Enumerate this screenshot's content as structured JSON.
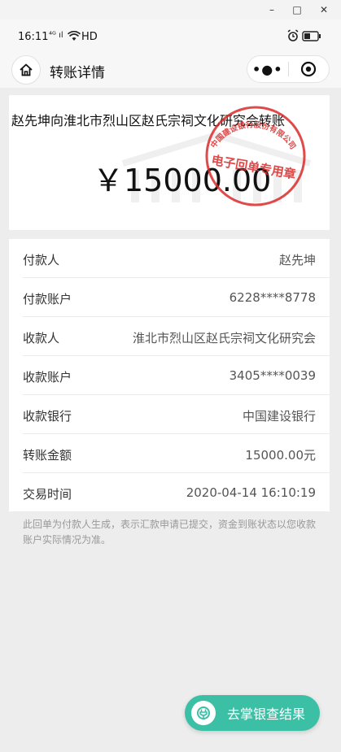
{
  "window": {
    "minimize": "–",
    "maximize": "□",
    "close": "✕"
  },
  "status": {
    "time": "16:11",
    "signal": "⁴ᴳ ıl",
    "network": "HD"
  },
  "nav": {
    "title": "转账详情",
    "more": "•●•"
  },
  "transfer": {
    "title": "赵先坤向淮北市烈山区赵氏宗祠文化研究会转账",
    "amount": "￥15000.00"
  },
  "seal": {
    "top_text": "中国建设银行股份有限公司",
    "bottom_text": "电子回单专用章"
  },
  "details": [
    {
      "label": "付款人",
      "value": "赵先坤"
    },
    {
      "label": "付款账户",
      "value": "6228****8778"
    },
    {
      "label": "收款人",
      "value": "淮北市烈山区赵氏宗祠文化研究会"
    },
    {
      "label": "收款账户",
      "value": "3405****0039"
    },
    {
      "label": "收款银行",
      "value": "中国建设银行"
    },
    {
      "label": "转账金额",
      "value": "15000.00元"
    },
    {
      "label": "交易时间",
      "value": "2020-04-14 16:10:19"
    }
  ],
  "note": "此回单为付款人生成，表示汇款申请已提交，资金到账状态以您收款账户实际情况为准。",
  "fab": {
    "label": "去掌银查结果"
  },
  "colors": {
    "accent": "#3bbfa5",
    "seal": "#d92b2b"
  }
}
